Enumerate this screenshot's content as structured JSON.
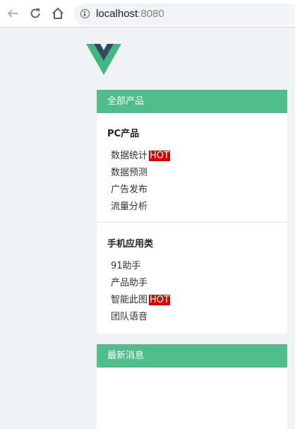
{
  "browser": {
    "url_host": "localhost",
    "url_port": ":8080"
  },
  "logo": {
    "name": "vue-logo",
    "colors": {
      "outer": "#41b883",
      "inner": "#35495e"
    }
  },
  "products_panel": {
    "title": "全部产品",
    "groups": [
      {
        "title": "PC产品",
        "items": [
          {
            "label": "数据统计",
            "hot": "HOT"
          },
          {
            "label": "数据预测"
          },
          {
            "label": "广告发布"
          },
          {
            "label": "流量分析"
          }
        ]
      },
      {
        "title": "手机应用类",
        "items": [
          {
            "label": "91助手"
          },
          {
            "label": "产品助手"
          },
          {
            "label": "智能此图",
            "hot": "HOT"
          },
          {
            "label": "团队语音"
          }
        ]
      }
    ]
  },
  "news_panel": {
    "title": "最新消息"
  },
  "colors": {
    "accent": "#4fbe8a",
    "hot": "#e00000",
    "background": "#f0f2f5"
  }
}
